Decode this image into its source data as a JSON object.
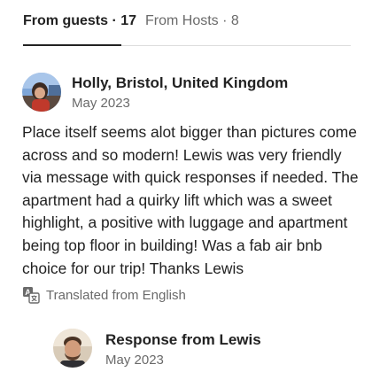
{
  "tabs": {
    "guests_label": "From guests · 17",
    "hosts_label": "From Hosts · 8"
  },
  "review": {
    "reviewer_name": "Holly, Bristol, United Kingdom",
    "date": "May 2023",
    "text": "Place itself seems alot bigger than pictures come across and so modern! Lewis was very friendly via message with quick responses if needed. The apartment had a quirky lift which was a sweet highlight, a positive with luggage and apartment being top floor in building! Was a fab air bnb choice for our trip! Thanks Lewis",
    "translated_label": "Translated from English",
    "translate_icon": "translate-icon"
  },
  "response": {
    "title": "Response from Lewis",
    "date": "May 2023"
  }
}
